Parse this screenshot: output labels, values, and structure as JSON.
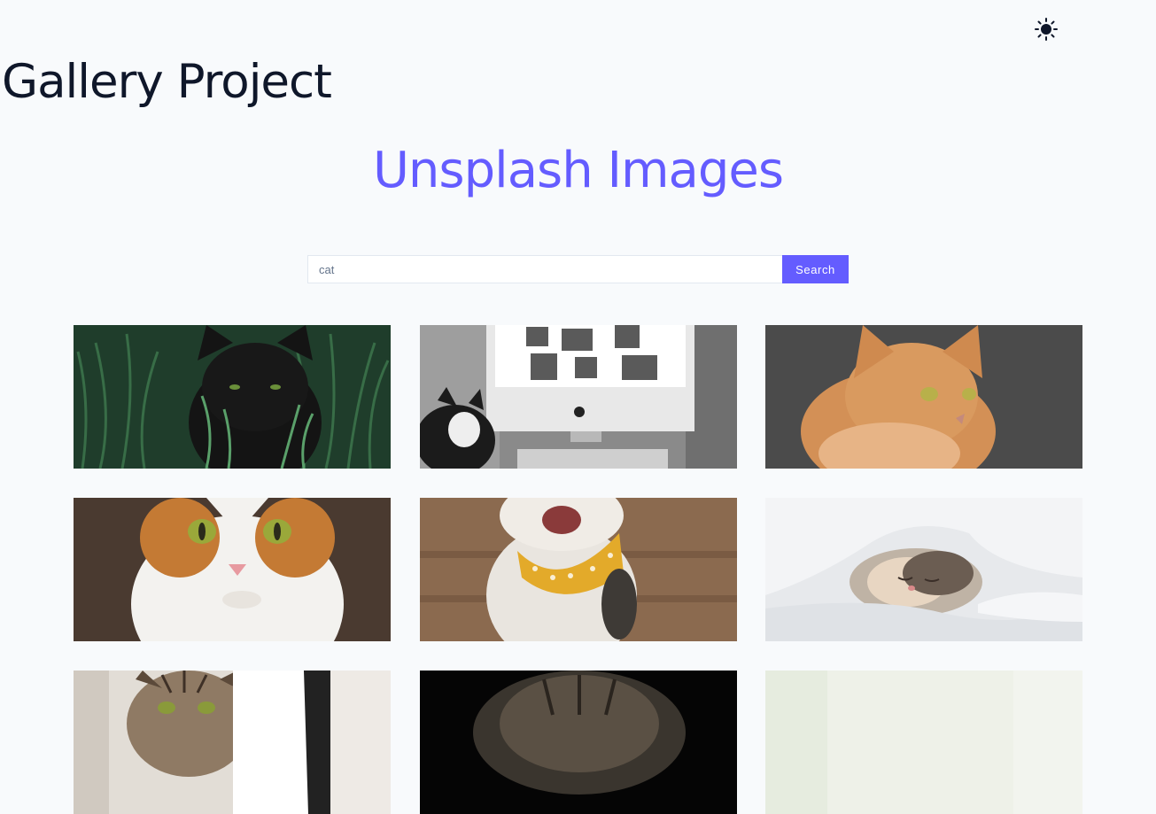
{
  "header": {
    "theme_toggle_icon": "sun-icon",
    "title": "Gallery Project"
  },
  "main": {
    "section_title": "Unsplash Images",
    "search": {
      "value": "cat",
      "button_label": "Search"
    },
    "images": [
      {
        "name": "black-cat-in-grass-image"
      },
      {
        "name": "cat-with-imac-image"
      },
      {
        "name": "orange-maine-coon-image"
      },
      {
        "name": "orange-white-cat-portrait-image"
      },
      {
        "name": "cat-with-yellow-bandana-image"
      },
      {
        "name": "cat-under-blanket-image"
      },
      {
        "name": "tabby-cat-image"
      },
      {
        "name": "cat-in-dark-image"
      },
      {
        "name": "light-green-image"
      }
    ]
  },
  "colors": {
    "background": "#f8fafc",
    "accent": "#645cff",
    "title_text": "#0f172a"
  }
}
